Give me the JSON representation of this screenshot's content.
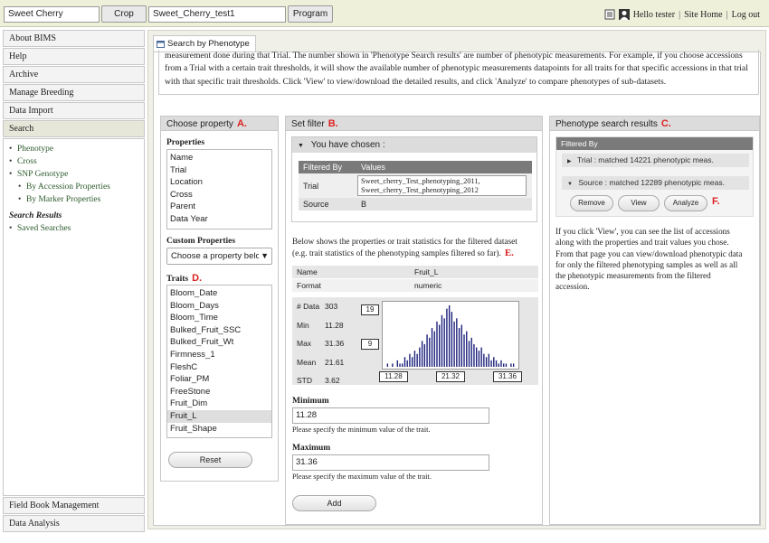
{
  "topbar": {
    "crop_value": "Sweet Cherry",
    "crop_button": "Crop",
    "program_value": "Sweet_Cherry_test1",
    "program_button": "Program",
    "greeting": "Hello tester",
    "site_home": "Site Home",
    "logout": "Log out",
    "separator": "|"
  },
  "sidebar": {
    "top_items": [
      "About BIMS",
      "Help",
      "Archive",
      "Manage Breeding",
      "Data Import",
      "Search"
    ],
    "search_links": [
      "Phenotype",
      "Cross",
      "SNP Genotype"
    ],
    "snp_sub": [
      "By Accession Properties",
      "By Marker Properties"
    ],
    "results_title": "Search Results",
    "saved": "Saved Searches",
    "bottom_items": [
      "Field Book Management",
      "Data Analysis"
    ]
  },
  "main": {
    "tab_label": "Search by Phenotype",
    "description_lines": [
      "measurement done during that Trial. The number shown in 'Phenotype Search results' are number of phenotypic measurements. For example, if you choose accessions",
      "from a Trial with a certain trait thresholds, it will show the available number of phenotypic measurements datapoints for all traits for that specific accessions in that trial",
      "with that specific trait thresholds. Click 'View' to view/download the detailed results, and click 'Analyze' to compare phenotypes of sub-datasets."
    ]
  },
  "choose_property": {
    "title": "Choose property",
    "marker": "A.",
    "properties_label": "Properties",
    "properties": [
      "Name",
      "Trial",
      "Location",
      "Cross",
      "Parent",
      "Data Year"
    ],
    "custom_label": "Custom Properties",
    "custom_placeholder": "Choose a property below",
    "traits_label": "Traits",
    "traits_marker": "D.",
    "traits": [
      "Bloom_Date",
      "Bloom_Days",
      "Bloom_Time",
      "Bulked_Fruit_SSC",
      "Bulked_Fruit_Wt",
      "Firmness_1",
      "FleshC",
      "Foliar_PM",
      "FreeStone",
      "Fruit_Dim",
      "Fruit_L",
      "Fruit_Shape"
    ],
    "selected_trait": "Fruit_L",
    "reset": "Reset"
  },
  "set_filter": {
    "title": "Set filter",
    "marker": "B.",
    "chosen_label": "You have chosen :",
    "col_filtered": "Filtered By",
    "col_values": "Values",
    "rows": [
      {
        "key": "Trial",
        "values": [
          "Sweet_cherry_Test_phenotyping_2011,",
          "Sweet_cherry_Test_phenotyping_2012"
        ]
      },
      {
        "key": "Source",
        "values": [
          "B"
        ]
      }
    ],
    "stats_desc_1": "Below shows the properties or trait statistics for the filtered dataset",
    "stats_desc_2": "(e.g. trait statistics of the phenotyping samples filtered so far).",
    "stats_marker": "E.",
    "name_label": "Name",
    "name_value": "Fruit_L",
    "format_label": "Format",
    "format_value": "numeric",
    "stats": [
      {
        "k": "# Data",
        "v": "303"
      },
      {
        "k": "Min",
        "v": "11.28"
      },
      {
        "k": "Max",
        "v": "31.36"
      },
      {
        "k": "Mean",
        "v": "21.61"
      },
      {
        "k": "STD",
        "v": "3.62"
      }
    ],
    "hist_top": "19",
    "hist_bottom": "9",
    "hist_axis": [
      "11.28",
      "21.32",
      "31.36"
    ],
    "min_label": "Minimum",
    "min_value": "11.28",
    "min_help": "Please specify the minimum value of the trait.",
    "max_label": "Maximum",
    "max_value": "31.36",
    "max_help": "Please specify the maximum value of the trait.",
    "add": "Add"
  },
  "results": {
    "title": "Phenotype search results",
    "marker": "C.",
    "filtered_by": "Filtered By",
    "trial_row": "Trial : matched 14221 phenotypic meas.",
    "source_row": "Source : matched 12289 phenotypic meas.",
    "remove": "Remove",
    "view": "View",
    "analyze": "Analyze",
    "btn_marker": "F.",
    "help_lines": [
      "If you click 'View', you can see the list of accessions",
      "along with the properties and trait values you chose.",
      "From that page you can view/download phenotypic data",
      "for only the filtered phenotyping samples as well as all",
      "the phenotypic measurements from the filtered",
      "accession."
    ]
  },
  "chart_data": {
    "type": "bar",
    "values": [
      1,
      0,
      1,
      0,
      2,
      1,
      1,
      3,
      2,
      4,
      3,
      5,
      4,
      6,
      8,
      7,
      10,
      9,
      12,
      11,
      14,
      13,
      16,
      15,
      18,
      19,
      17,
      14,
      15,
      12,
      13,
      10,
      11,
      8,
      9,
      7,
      6,
      5,
      6,
      4,
      3,
      4,
      2,
      3,
      2,
      1,
      2,
      1,
      1,
      0,
      1,
      1
    ],
    "ylim": [
      0,
      19
    ]
  },
  "colors": {
    "topbar": "#eef0da",
    "panel_header": "#dcdcdc",
    "table_header": "#7a7a7a",
    "bars": "#1a1f7a",
    "marker": "#dd2222"
  }
}
